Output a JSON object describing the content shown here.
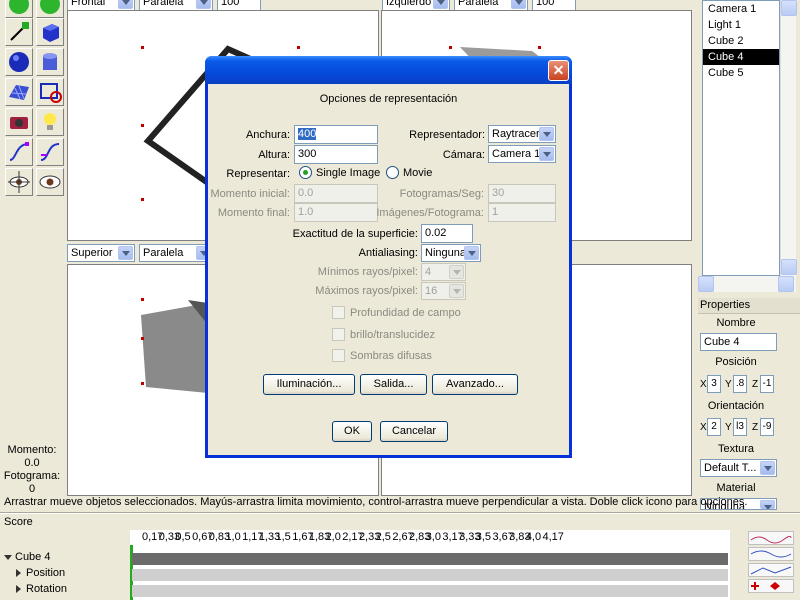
{
  "viewports": {
    "top_left": {
      "view": "Frontal",
      "projection": "Paralela",
      "zoom": "100"
    },
    "top_right": {
      "view": "Izquierdo",
      "projection": "Paralela",
      "zoom": "100"
    },
    "bottom_left": {
      "view": "Superior",
      "projection": "Paralela"
    }
  },
  "scene_list": {
    "items": [
      "Camera 1",
      "Light 1",
      "Cube 2",
      "Cube 4",
      "Cube 5"
    ],
    "selected": "Cube 4"
  },
  "properties": {
    "title": "Properties",
    "name_label": "Nombre",
    "name_value": "Cube 4",
    "position_label": "Posición",
    "position": {
      "x": "3",
      "y": ".8",
      "z": "-1"
    },
    "orientation_label": "Orientación",
    "orientation": {
      "x": "2",
      "y": "l3",
      "z": "-9"
    },
    "axis_x": "X",
    "axis_y": "Y",
    "axis_z": "Z",
    "texture_label": "Textura",
    "texture_value": "Default T...",
    "material_label": "Material",
    "material_value": "Ninguna"
  },
  "status": {
    "moment_label": "Momento:",
    "moment_value": "0.0",
    "frame_label": "Fotograma:",
    "frame_value": "0",
    "hint": "Arrastrar mueve objetos seleccionados. Mayús-arrastra limita movimiento, control-arrastra mueve perpendicular a vista. Doble click icono para opciones."
  },
  "score": {
    "label": "Score",
    "ticks": [
      "0,17",
      "0,33",
      "0,5",
      "0,67",
      "0,83",
      "1,0",
      "1,17",
      "1,33",
      "1,5",
      "1,67",
      "1,83",
      "2,0",
      "2,17",
      "2,33",
      "2,5",
      "2,67",
      "2,83",
      "3,0",
      "3,17",
      "3,33",
      "3,5",
      "3,67",
      "3,83",
      "4,0",
      "4,17"
    ],
    "tracks": [
      {
        "label": "Cube 4",
        "expanded": true
      },
      {
        "label": "Position",
        "expanded": false
      },
      {
        "label": "Rotation",
        "expanded": false
      }
    ]
  },
  "dialog": {
    "title": "Opciones de representación",
    "width_label": "Anchura:",
    "width_value": "400",
    "height_label": "Altura:",
    "height_value": "300",
    "renderer_label": "Representador:",
    "renderer_value": "Raytracer",
    "camera_label": "Cámara:",
    "camera_value": "Camera 1",
    "render_label": "Representar:",
    "render_options": [
      "Single Image",
      "Movie"
    ],
    "render_selected": "Single Image",
    "start_label": "Momento inicial:",
    "start_value": "0.0",
    "end_label": "Momento final:",
    "end_value": "1.0",
    "fps_label": "Fotogramas/Seg:",
    "fps_value": "30",
    "ipf_label": "Imágenes/Fotograma:",
    "ipf_value": "1",
    "accuracy_label": "Exactitud de la superficie:",
    "accuracy_value": "0.02",
    "antialias_label": "Antialiasing:",
    "antialias_value": "Ninguna",
    "min_rays_label": "Mínimos rayos/pixel:",
    "min_rays_value": "4",
    "max_rays_label": "Máximos rayos/pixel:",
    "max_rays_value": "16",
    "checkboxes": [
      "Profundidad de campo",
      "brillo/translucidez",
      "Sombras difusas"
    ],
    "btn_lighting": "Iluminación...",
    "btn_output": "Salida...",
    "btn_advanced": "Avanzado...",
    "btn_ok": "OK",
    "btn_cancel": "Cancelar",
    "close_glyph": "✕"
  }
}
